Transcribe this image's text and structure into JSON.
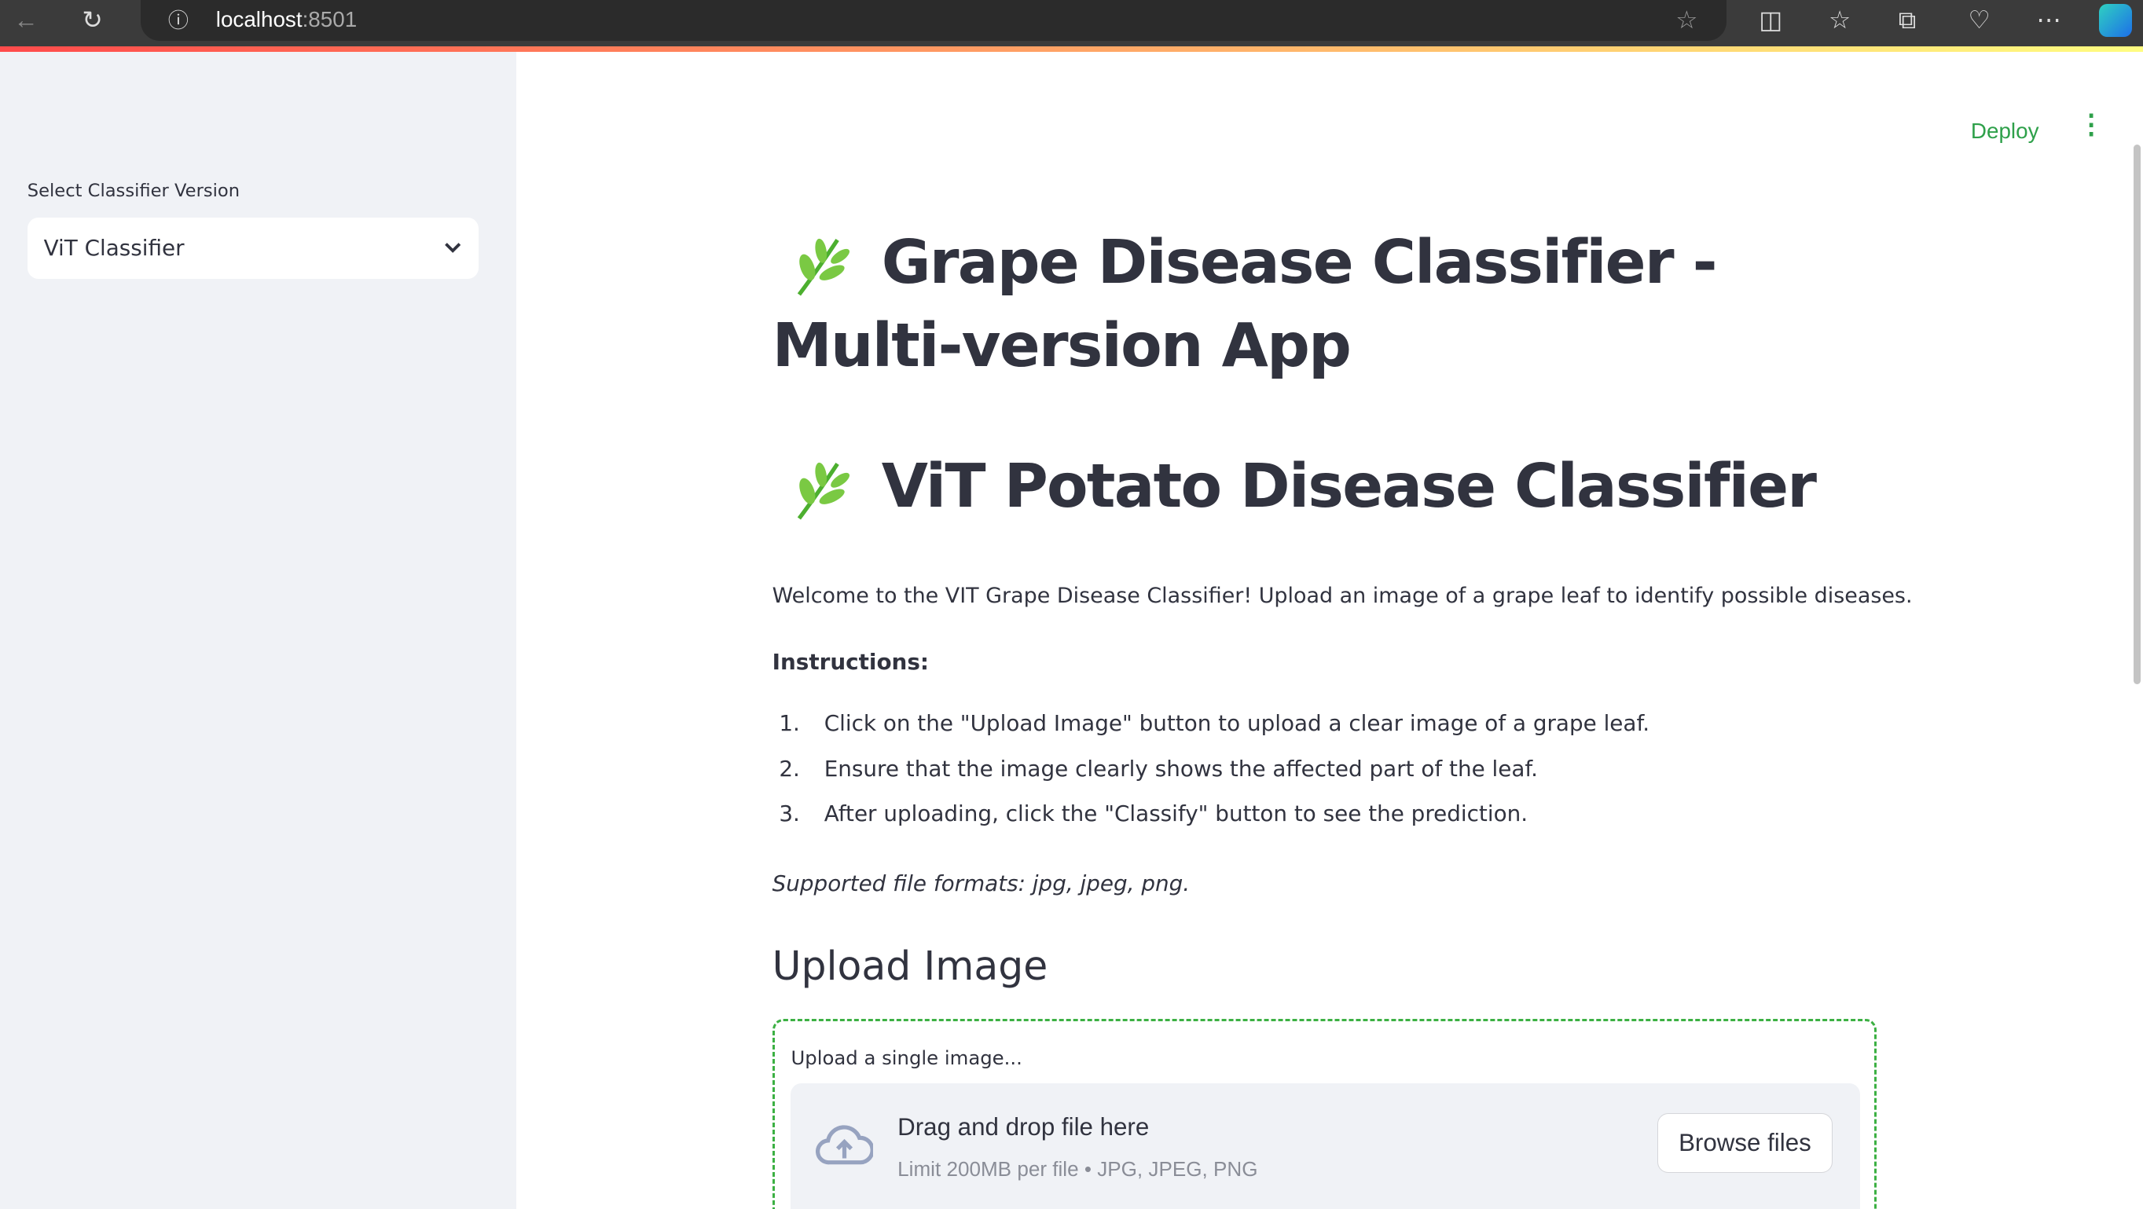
{
  "browser": {
    "url_host": "localhost",
    "url_port": ":8501"
  },
  "sidebar": {
    "select_label": "Select Classifier Version",
    "selected": "ViT Classifier"
  },
  "header": {
    "deploy": "Deploy"
  },
  "main": {
    "title": "Grape Disease Classifier - Multi-version App",
    "subtitle": "ViT Potato Disease Classifier",
    "welcome": "Welcome to the VIT Grape Disease Classifier! Upload an image of a grape leaf to identify possible diseases.",
    "instructions_heading": "Instructions:",
    "instructions": [
      {
        "n": "1.",
        "text": "Click on the \"Upload Image\" button to upload a clear image of a grape leaf."
      },
      {
        "n": "2.",
        "text": "Ensure that the image clearly shows the affected part of the leaf."
      },
      {
        "n": "3.",
        "text": "After uploading, click the \"Classify\" button to see the prediction."
      }
    ],
    "formats": "Supported file formats: jpg, jpeg, png.",
    "upload_heading": "Upload Image",
    "uploader": {
      "label": "Upload a single image...",
      "drop_title": "Drag and drop file here",
      "drop_sub": "Limit 200MB per file • JPG, JPEG, PNG",
      "browse": "Browse files"
    }
  }
}
